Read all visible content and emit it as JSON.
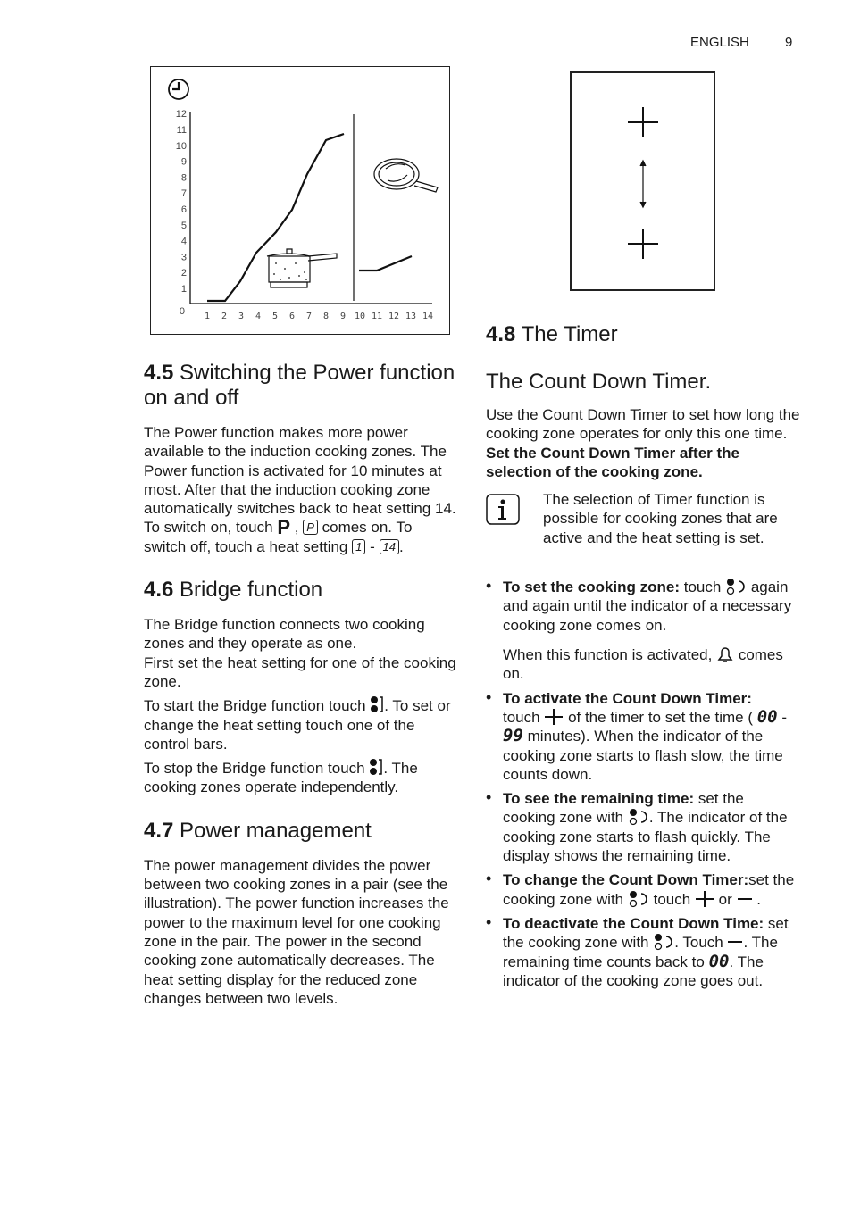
{
  "header": {
    "language": "ENGLISH",
    "page_number": "9"
  },
  "figure_power": {
    "y_ticks": [
      "0",
      "1",
      "2",
      "3",
      "4",
      "5",
      "6",
      "7",
      "8",
      "9",
      "10",
      "11",
      "12"
    ],
    "x_ticks": [
      "1",
      "2",
      "3",
      "4",
      "5",
      "6",
      "7",
      "8",
      "9",
      "10",
      "11",
      "12",
      "13",
      "14"
    ],
    "icons": [
      "clock-icon",
      "saucepan-icon",
      "frying-pan-icon"
    ]
  },
  "figure_timer": {
    "icons": [
      "plus-icon",
      "double-arrow-icon",
      "plus-icon"
    ]
  },
  "s45": {
    "num": "4.5",
    "title": "Switching the Power function on and off",
    "p1": "The Power function makes more power available to the induction cooking zones. The Power function is activated for 10 minutes at most. After that the induction cooking zone automatically switches back to heat setting 14. To switch on, touch",
    "sym_p": "P",
    "sep1": ",",
    "box_p": "P",
    "p2": "comes on. To switch off, touch a heat setting",
    "box_1": "1",
    "dash": "-",
    "box_14": "14",
    "end": "."
  },
  "s46": {
    "num": "4.6",
    "title": "Bridge function",
    "p1": "The Bridge function connects two cooking zones and they operate as one.",
    "p2": "First set the heat setting for one of the cooking zone.",
    "p3a": "To start the Bridge function touch",
    "p3b": ". To set or change the heat setting touch one of the control bars.",
    "p4a": "To stop the Bridge function touch",
    "p4b": ". The cooking zones operate independently."
  },
  "s47": {
    "num": "4.7",
    "title": "Power management",
    "p1": "The power management divides the power between two cooking zones in a pair (see the illustration). The power function increases the power to the maximum level for one cooking zone in the pair. The power in the second cooking zone automatically decreases. The heat setting display for the reduced zone changes between two levels."
  },
  "s48": {
    "num": "4.8",
    "title": "The Timer",
    "subtitle": "The Count Down Timer.",
    "p1": "Use the Count Down Timer to set how long the cooking zone operates for only this one time.",
    "p2": "Set the Count Down Timer after the selection of the cooking zone.",
    "info": "The selection of Timer function is possible for cooking zones that are active and the heat setting is set.",
    "items": [
      {
        "bold": "To set the cooking zone:",
        "a": " touch",
        "b": "again and again until the indicator of a necessary cooking zone comes on.",
        "note_a": "When this function is activated,",
        "note_b": "comes on."
      },
      {
        "bold": "To activate the Count Down Timer:",
        "a": "touch",
        "b": "of the timer to set the time (",
        "d1": "00",
        "dash": "-",
        "d2": "99",
        "c": "minutes). When the indicator of the cooking zone starts to flash slow, the time counts down."
      },
      {
        "bold": "To see the remaining time:",
        "a": " set the cooking zone with",
        "b": ". The indicator of the cooking zone starts to flash quickly. The display shows the remaining time."
      },
      {
        "bold": "To change the Count Down Timer:",
        "a": "set the cooking zone with",
        "b": "touch",
        "or": "or",
        "end": "."
      },
      {
        "bold": "To deactivate the Count Down Time:",
        "a": " set the cooking zone with",
        "b": ". Touch",
        "c": ". The remaining time counts back to",
        "d": "00",
        "e": ". The indicator of the cooking zone goes out."
      }
    ]
  }
}
